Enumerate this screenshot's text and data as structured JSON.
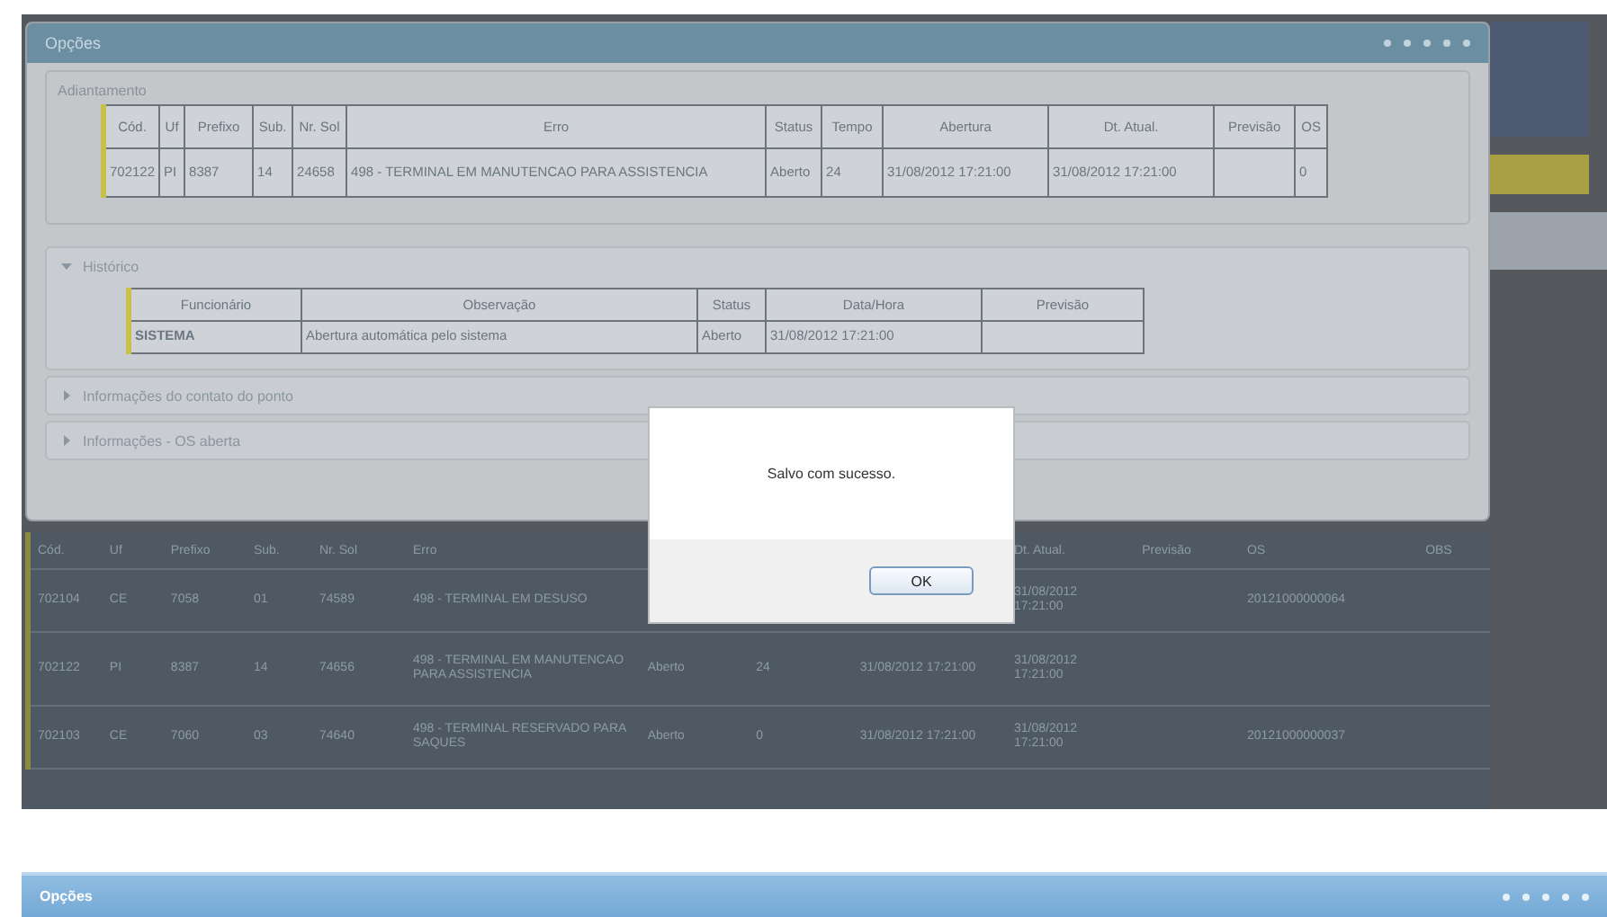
{
  "dialog": {
    "title": "Opções",
    "adiantamento": {
      "legend": "Adiantamento",
      "columns": [
        "Cód.",
        "Uf",
        "Prefixo",
        "Sub.",
        "Nr. Sol",
        "Erro",
        "Status",
        "Tempo",
        "Abertura",
        "Dt. Atual.",
        "Previsão",
        "OS"
      ],
      "rows": [
        [
          "702122",
          "PI",
          "8387",
          "14",
          "24658",
          "498 - TERMINAL EM MANUTENCAO PARA ASSISTENCIA",
          "Aberto",
          "24",
          "31/08/2012 17:21:00",
          "31/08/2012 17:21:00",
          "",
          "0"
        ]
      ]
    },
    "historico": {
      "title": "Histórico",
      "expanded": true,
      "columns": [
        "Funcionário",
        "Observação",
        "Status",
        "Data/Hora",
        "Previsão"
      ],
      "rows": [
        [
          "SISTEMA",
          "Abertura automática pelo sistema",
          "Aberto",
          "31/08/2012 17:21:00",
          ""
        ]
      ]
    },
    "sections": [
      {
        "title": "Informações do contato do ponto",
        "expanded": false
      },
      {
        "title": "Informações - OS aberta",
        "expanded": false
      }
    ]
  },
  "background_table": {
    "columns": [
      "Cód.",
      "Uf",
      "Prefixo",
      "Sub.",
      "Nr. Sol",
      "Erro",
      null,
      null,
      null,
      "Dt. Atual.",
      "Previsão",
      "OS",
      "OBS"
    ],
    "rows": [
      [
        "702104",
        "CE",
        "7058",
        "01",
        "74589",
        "498 - TERMINAL EM DESUSO",
        null,
        null,
        null,
        "31/08/2012 17:21:00",
        "",
        "20121000000064",
        ""
      ],
      [
        "702122",
        "PI",
        "8387",
        "14",
        "74656",
        "498 - TERMINAL EM MANUTENCAO PARA ASSISTENCIA",
        "Aberto",
        "24",
        "31/08/2012 17:21:00",
        "31/08/2012 17:21:00",
        "",
        "",
        ""
      ],
      [
        "702103",
        "CE",
        "7060",
        "03",
        "74640",
        "498 - TERMINAL RESERVADO PARA SAQUES",
        "Aberto",
        "0",
        "31/08/2012 17:21:00",
        "31/08/2012 17:21:00",
        "",
        "20121000000037",
        ""
      ]
    ]
  },
  "message_box": {
    "text": "Salvo com sucesso.",
    "button": "OK"
  },
  "second_window": {
    "title": "Opções"
  }
}
